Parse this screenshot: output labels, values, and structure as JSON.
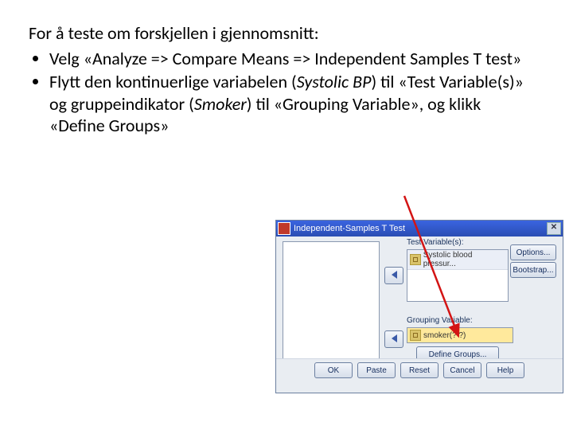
{
  "text": {
    "intro": "For å teste om forskjellen i gjennomsnitt:",
    "b1a": "Velg «Analyze => Compare Means => Independent Samples T test»",
    "b2a": "Flytt den kontinuerlige variabelen (",
    "b2var1": "Systolic BP",
    "b2b": ") til «Test Variable(s)» og gruppeindikator (",
    "b2var2": "Smoker",
    "b2c": ") til «Grouping Variable», og klikk «Define Groups»"
  },
  "dlg": {
    "title": "Independent-Samples T Test",
    "lbl_test": "Test Variable(s):",
    "row_var": "Systolic blood pressur...",
    "lbl_group": "Grouping Variable:",
    "group_val": "smoker(? ?)",
    "define": "Define Groups...",
    "options": "Options...",
    "bootstrap": "Bootstrap...",
    "ok": "OK",
    "paste": "Paste",
    "reset": "Reset",
    "cancel": "Cancel",
    "help": "Help"
  }
}
